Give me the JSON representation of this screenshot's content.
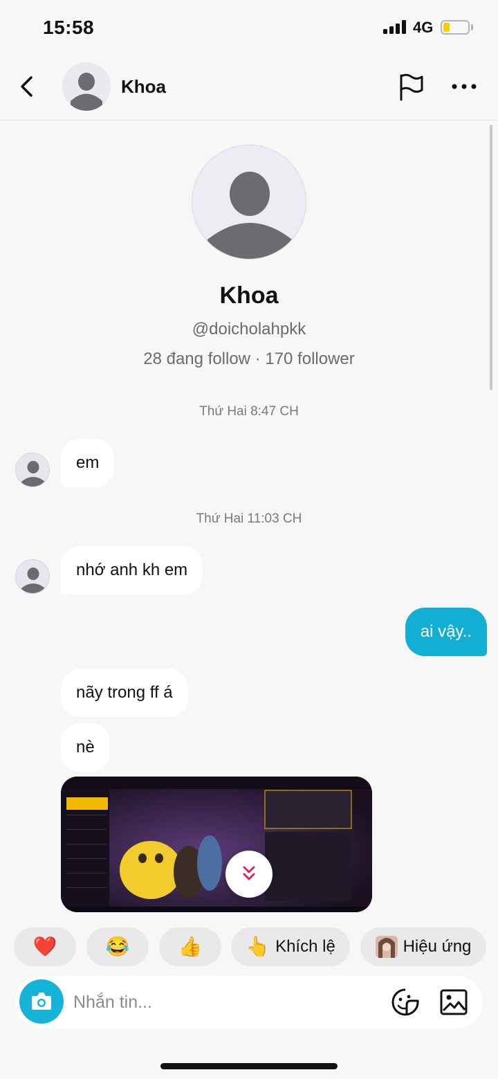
{
  "status_bar": {
    "time": "15:58",
    "network": "4G"
  },
  "header": {
    "name": "Khoa"
  },
  "profile": {
    "name": "Khoa",
    "handle": "@doicholahpkk",
    "stats": "28 đang follow · 170 follower"
  },
  "messages": [
    {
      "type": "timestamp",
      "text": "Thứ Hai 8:47 CH"
    },
    {
      "type": "received",
      "text": "em"
    },
    {
      "type": "timestamp",
      "text": "Thứ Hai 11:03 CH"
    },
    {
      "type": "received",
      "text": "nhớ anh kh em"
    },
    {
      "type": "sent",
      "text": "ai vậy.."
    },
    {
      "type": "received",
      "text": "nãy trong ff á"
    },
    {
      "type": "received",
      "text": "nè"
    },
    {
      "type": "received_image",
      "text": ""
    }
  ],
  "quick_replies": [
    {
      "emoji": "❤️",
      "label": ""
    },
    {
      "emoji": "😂",
      "label": ""
    },
    {
      "emoji": "👍",
      "label": ""
    },
    {
      "emoji": "👆",
      "label": "Khích lệ"
    },
    {
      "emoji": "",
      "label": "Hiệu ứng"
    }
  ],
  "composer": {
    "placeholder": "Nhắn tin..."
  },
  "colors": {
    "accent": "#13aed4",
    "background": "#f7f7f7",
    "bubble_received": "#ffffff"
  }
}
